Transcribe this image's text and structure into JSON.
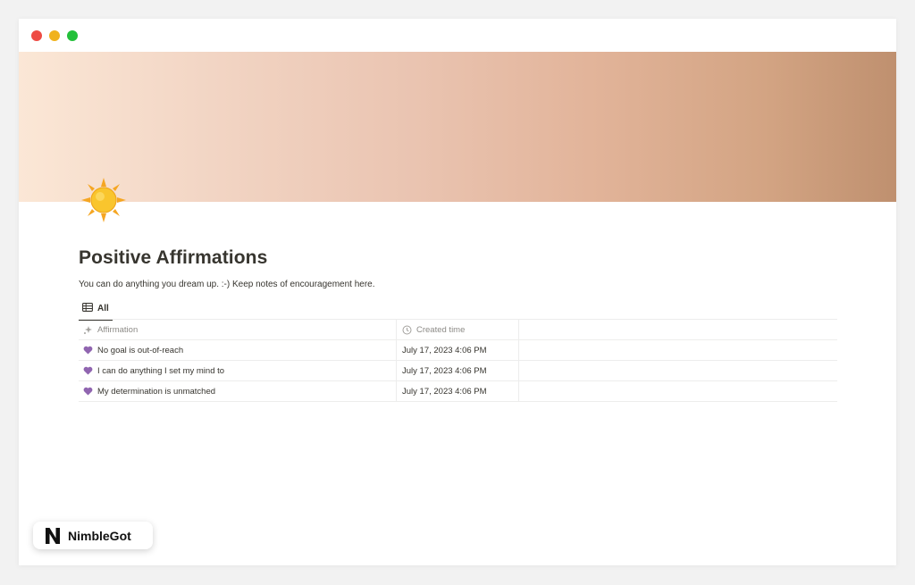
{
  "page": {
    "icon": "sun-emoji",
    "title": "Positive Affirmations",
    "description": "You can do anything you dream up. :-) Keep notes of encouragement here."
  },
  "view": {
    "tab_label": "All",
    "tab_icon": "table-icon"
  },
  "table": {
    "columns": [
      {
        "label": "Affirmation",
        "icon": "sparkle-icon"
      },
      {
        "label": "Created time",
        "icon": "clock-icon"
      }
    ],
    "rows": [
      {
        "affirmation": "No goal is out-of-reach",
        "created": "July 17, 2023 4:06 PM",
        "icon": "purple-heart-icon"
      },
      {
        "affirmation": "I can do anything I set my mind to",
        "created": "July 17, 2023 4:06 PM",
        "icon": "purple-heart-icon"
      },
      {
        "affirmation": "My determination is unmatched",
        "created": "July 17, 2023 4:06 PM",
        "icon": "purple-heart-icon"
      }
    ]
  },
  "brand": {
    "name": "NimbleGot",
    "logo": "N"
  },
  "colors": {
    "text": "#37352f",
    "muted": "#8d8b87",
    "heart": "#9065b0",
    "window_red": "#ee4b44",
    "window_yellow": "#f0b21d",
    "window_green": "#23c03a"
  }
}
